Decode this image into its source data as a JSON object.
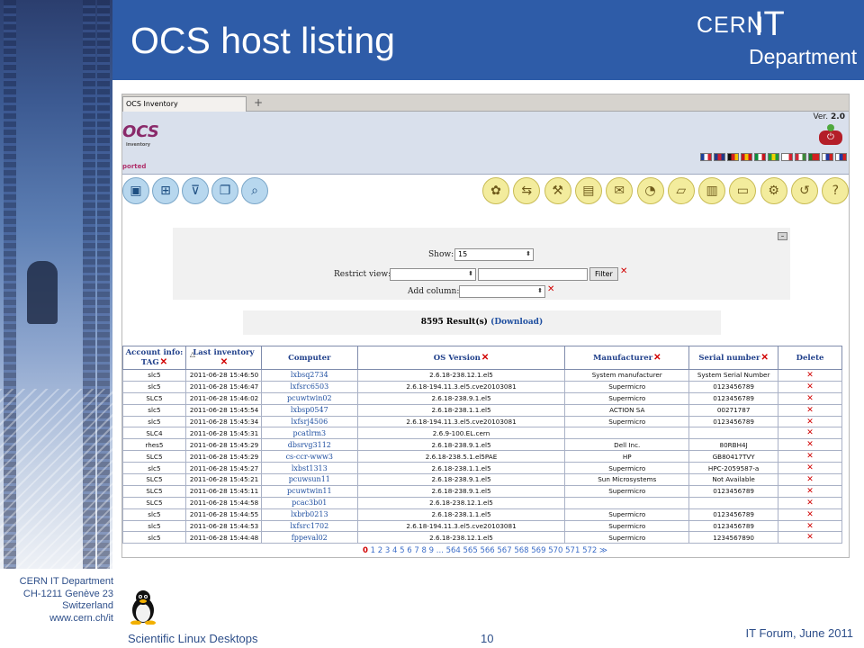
{
  "slide": {
    "title": "OCS host listing",
    "brand": {
      "cern": "CERN",
      "it": "IT",
      "department": "Department"
    },
    "footer": {
      "address": [
        "CERN IT Department",
        "CH-1211 Genève 23",
        "Switzerland",
        "www.cern.ch/it"
      ],
      "title": "Scientific Linux Desktops",
      "page": "10",
      "event": "IT Forum, June 2011"
    }
  },
  "browser": {
    "tab_label": "OCS Inventory",
    "new_tab": "+"
  },
  "ocs": {
    "logo": "OCS",
    "logo_sub": "inventory",
    "version_label": "Ver.",
    "version": "2.0",
    "section": "ported",
    "flags": [
      [
        "#1a3f9a",
        "#ffffff",
        "#d22030"
      ],
      [
        "#1f3a8a",
        "#cc2233",
        "#1f3a8a"
      ],
      [
        "#111111",
        "#d22020",
        "#f2c200"
      ],
      [
        "#c8141e",
        "#f2c200",
        "#c8141e"
      ],
      [
        "#0b8e3c",
        "#ffffff",
        "#c8141e"
      ],
      [
        "#1f9a3a",
        "#f2d200",
        "#1f9a3a"
      ],
      [
        "#ffffff",
        "#ffffff",
        "#d42030"
      ],
      [
        "#ce2a3a",
        "#ffffff",
        "#3d8a3a"
      ],
      [
        "#1a7a2a",
        "#d22020",
        "#d22020"
      ],
      [
        "#ffffff",
        "#1f3aa0",
        "#d22020"
      ],
      [
        "#ffffff",
        "#1f3aa0",
        "#d22020"
      ]
    ],
    "nav_icons": [
      "computers-icon",
      "groups-icon",
      "filter-icon",
      "duplicates-icon",
      "search-icon"
    ],
    "plugin_icons": [
      "packages-icon",
      "deploy-icon",
      "tools-icon",
      "dictionary-icon",
      "registry-icon",
      "ipdiscover-icon",
      "reports-icon",
      "statistics-icon",
      "config-icon",
      "agent-icon",
      "help-back-icon",
      "help-icon"
    ]
  },
  "filters": {
    "show_label": "Show:",
    "show_value": "15",
    "restrict_label": "Restrict view:",
    "restrict_value": "",
    "restrict_text": "",
    "filter_button": "Filter",
    "add_column_label": "Add column:",
    "add_column_value": ""
  },
  "results": {
    "count_text": "8595 Result(s)",
    "download_text": "(Download)"
  },
  "table": {
    "headers": [
      "Account info: TAG",
      "Last inventory",
      "Computer",
      "OS Version",
      "Manufacturer",
      "Serial number",
      "Delete"
    ],
    "rows": [
      [
        "slc5",
        "2011-06-28 15:46:50",
        "lxbsq2734",
        "2.6.18-238.12.1.el5",
        "System manufacturer",
        "System Serial Number"
      ],
      [
        "slc5",
        "2011-06-28 15:46:47",
        "lxfsrc6503",
        "2.6.18-194.11.3.el5.cve20103081",
        "Supermicro",
        "0123456789"
      ],
      [
        "SLC5",
        "2011-06-28 15:46:02",
        "pcuwtwin02",
        "2.6.18-238.9.1.el5",
        "Supermicro",
        "0123456789"
      ],
      [
        "slc5",
        "2011-06-28 15:45:54",
        "lxbsp0547",
        "2.6.18-238.1.1.el5",
        "ACTION SA",
        "00271787"
      ],
      [
        "slc5",
        "2011-06-28 15:45:34",
        "lxfsrj4506",
        "2.6.18-194.11.3.el5.cve20103081",
        "Supermicro",
        "0123456789"
      ],
      [
        "SLC4",
        "2011-06-28 15:45:31",
        "pcatlrm3",
        "2.6.9-100.EL.cern",
        "",
        ""
      ],
      [
        "rhes5",
        "2011-06-28 15:45:29",
        "dbsrvg3112",
        "2.6.18-238.9.1.el5",
        "Dell Inc.",
        "80RBH4J"
      ],
      [
        "SLC5",
        "2011-06-28 15:45:29",
        "cs-ccr-www3",
        "2.6.18-238.5.1.el5PAE",
        "HP",
        "GB80417TVY"
      ],
      [
        "slc5",
        "2011-06-28 15:45:27",
        "lxbst1313",
        "2.6.18-238.1.1.el5",
        "Supermicro",
        "HPC-2059587-a"
      ],
      [
        "SLC5",
        "2011-06-28 15:45:21",
        "pcuwsun11",
        "2.6.18-238.9.1.el5",
        "Sun Microsystems",
        "Not Available"
      ],
      [
        "SLC5",
        "2011-06-28 15:45:11",
        "pcuwtwin11",
        "2.6.18-238.9.1.el5",
        "Supermicro",
        "0123456789"
      ],
      [
        "SLC5",
        "2011-06-28 15:44:58",
        "pcac3b01",
        "2.6.18-238.12.1.el5",
        "",
        ""
      ],
      [
        "slc5",
        "2011-06-28 15:44:55",
        "lxbrb0213",
        "2.6.18-238.1.1.el5",
        "Supermicro",
        "0123456789"
      ],
      [
        "slc5",
        "2011-06-28 15:44:53",
        "lxfsrc1702",
        "2.6.18-194.11.3.el5.cve20103081",
        "Supermicro",
        "0123456789"
      ],
      [
        "slc5",
        "2011-06-28 15:44:48",
        "fppeval02",
        "2.6.18-238.12.1.el5",
        "Supermicro",
        "1234567890"
      ]
    ],
    "delete_symbol": "✕"
  },
  "pager": {
    "current": "0",
    "pages": [
      "1",
      "2",
      "3",
      "4",
      "5",
      "6",
      "7",
      "8",
      "9"
    ],
    "ellipsis": "...",
    "tail_pages": [
      "564",
      "565",
      "566",
      "567",
      "568",
      "569",
      "570",
      "571",
      "572"
    ],
    "next": "≫"
  },
  "colors": {
    "title_bar": "#2e5ca8",
    "link": "#1f4fa0",
    "delete": "#d10000"
  }
}
